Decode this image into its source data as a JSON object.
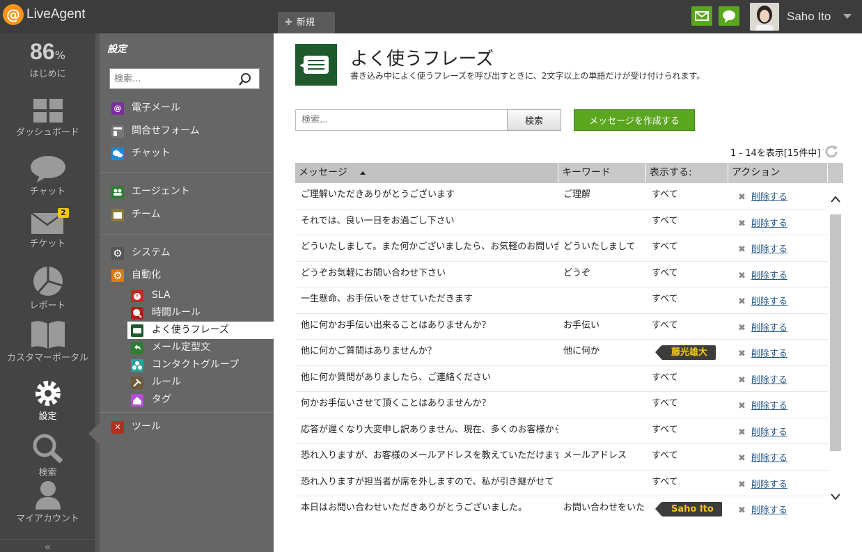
{
  "app": {
    "brand": "LiveAgent",
    "logo_glyph": "@"
  },
  "top": {
    "new_tab": "新規",
    "user_name": "Saho Ito",
    "accent": "#5aa61e"
  },
  "leftnav": {
    "progress": "86",
    "progress_unit": "%",
    "items": [
      {
        "label": "はじめに"
      },
      {
        "label": "ダッシュボード"
      },
      {
        "label": "チャット"
      },
      {
        "label": "チケット",
        "badge": "2"
      },
      {
        "label": "レポート"
      },
      {
        "label": "カスタマーポータル"
      },
      {
        "label": "設定"
      },
      {
        "label": "検索"
      },
      {
        "label": "マイアカウント"
      }
    ],
    "collapse": "«"
  },
  "settings": {
    "title": "設定",
    "search_placeholder": "検索...",
    "groups": [
      {
        "label": "電子メール",
        "glyph": "@",
        "color": "#7b2f9e"
      },
      {
        "label": "問合せフォーム",
        "glyph": "",
        "color": "#777777"
      },
      {
        "label": "チャット",
        "glyph": "",
        "color": "#1e8ad6"
      },
      {
        "label": "エージェント",
        "glyph": "",
        "color": "#2e7d32"
      },
      {
        "label": "チーム",
        "glyph": "",
        "color": "#8a7a3a"
      },
      {
        "label": "システム",
        "glyph": "⚙",
        "color": "#555555"
      },
      {
        "label": "自動化",
        "glyph": "⚙",
        "color": "#e07a10"
      },
      {
        "label": "ツール",
        "glyph": "✕",
        "color": "#b03020"
      }
    ],
    "automation_sub": [
      {
        "label": "SLA",
        "color": "#c62828"
      },
      {
        "label": "時間ルール",
        "color": "#b71c1c"
      },
      {
        "label": "よく使うフレーズ",
        "color": "#1f5a2c"
      },
      {
        "label": "メール定型文",
        "color": "#2e7d32"
      },
      {
        "label": "コンタクトグループ",
        "color": "#26a69a"
      },
      {
        "label": "ルール",
        "color": "#6d5a3a"
      },
      {
        "label": "タグ",
        "color": "#b44fd6"
      }
    ]
  },
  "main": {
    "title": "よく使うフレーズ",
    "description": "書き込み中によく使うフレーズを呼び出すときに、2文字以上の単語だけが受け付けられます。",
    "search_placeholder": "検索...",
    "search_button": "検索",
    "create_button": "メッセージを作成する",
    "pager": "1 - 14を表示[15件中]",
    "columns": [
      "メッセージ",
      "キーワード",
      "表示する:",
      "アクション"
    ],
    "delete_label": "削除する",
    "rows": [
      {
        "message": "ご理解いただきありがとうございます",
        "keyword": "ご理解",
        "display": "すべて",
        "tag": ""
      },
      {
        "message": "それでは、良い一日をお過ごし下さい",
        "keyword": "",
        "display": "すべて",
        "tag": ""
      },
      {
        "message": "どういたしまして。また何かございましたら、お気軽のお問い合わせ",
        "keyword": "どういたしまして",
        "display": "すべて",
        "tag": ""
      },
      {
        "message": "どうぞお気軽にお問い合わせ下さい",
        "keyword": "どうぞ",
        "display": "すべて",
        "tag": ""
      },
      {
        "message": "一生懸命、お手伝いをさせていただきます",
        "keyword": "",
        "display": "すべて",
        "tag": ""
      },
      {
        "message": "他に何かお手伝い出来ることはありませんか？",
        "keyword": "お手伝い",
        "display": "すべて",
        "tag": ""
      },
      {
        "message": "他に何かご質問はありませんか？",
        "keyword": "他に何か",
        "display": "",
        "tag": "藤光雄大"
      },
      {
        "message": "他に何か質問がありましたら、ご連絡ください",
        "keyword": "",
        "display": "すべて",
        "tag": ""
      },
      {
        "message": "何かお手伝いさせて頂くことはありませんか？",
        "keyword": "",
        "display": "すべて",
        "tag": ""
      },
      {
        "message": "応答が遅くなり大変申し訳ありません、現在、多くのお客様からお",
        "keyword": "",
        "display": "すべて",
        "tag": ""
      },
      {
        "message": "恐れ入りますが、お客様のメールアドレスを教えていただけますか",
        "keyword": "メールアドレス",
        "display": "すべて",
        "tag": ""
      },
      {
        "message": "恐れ入りますが担当者が席を外しますので、私が引き継がせて",
        "keyword": "",
        "display": "すべて",
        "tag": ""
      },
      {
        "message": "本日はお問い合わせいただきありがとうございました。",
        "keyword": "お問い合わせをいた",
        "display": "",
        "tag": "Saho Ito"
      }
    ]
  }
}
